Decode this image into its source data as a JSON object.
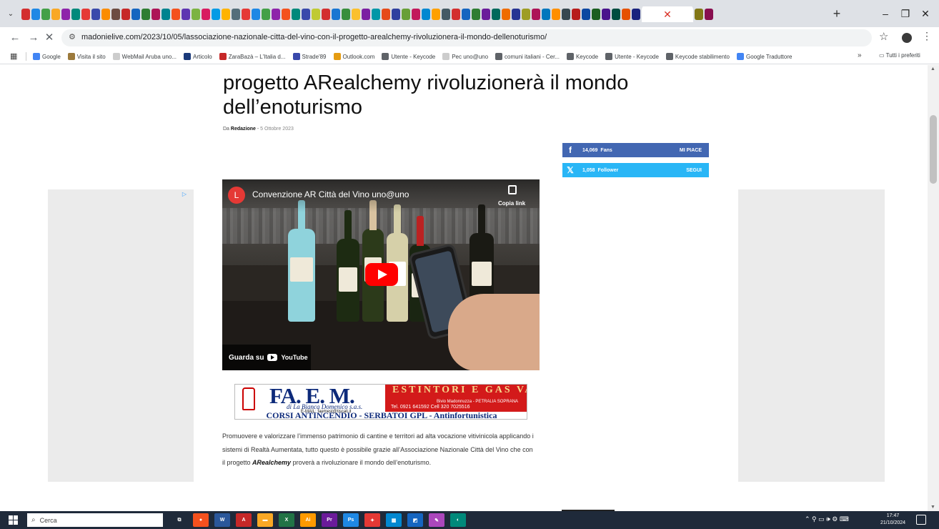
{
  "browser": {
    "url": "madonielive.com/2023/10/05/lassociazione-nazionale-citta-del-vino-con-il-progetto-arealchemy-rivoluzionera-il-mondo-dellenoturismo/",
    "bookmarks": [
      {
        "label": "Google",
        "color": "#4285f4"
      },
      {
        "label": "Visita il sito",
        "color": "#9c7a3c"
      },
      {
        "label": "WebMail Aruba uno...",
        "color": "#cccccc"
      },
      {
        "label": "Articolo",
        "color": "#1a3a7a"
      },
      {
        "label": "ZaraBazà – L'Italia d...",
        "color": "#c62828"
      },
      {
        "label": "Strade'89",
        "color": "#3949ab"
      },
      {
        "label": "Outlook.com",
        "color": "#e59c12"
      },
      {
        "label": "Utente - Keycode",
        "color": "#5f6368"
      },
      {
        "label": "Pec uno@uno",
        "color": "#cccccc"
      },
      {
        "label": "comuni italiani - Cer...",
        "color": "#5f6368"
      },
      {
        "label": "Keycode",
        "color": "#5f6368"
      },
      {
        "label": "Utente - Keycode",
        "color": "#5f6368"
      },
      {
        "label": "Keycode stabilimento",
        "color": "#5f6368"
      },
      {
        "label": "Google Traduttore",
        "color": "#4285f4"
      }
    ],
    "bookmarks_more": "»",
    "all_bookmarks": "Tutti i preferiti"
  },
  "article": {
    "title": "progetto ARealchemy rivoluzionerà il mondo dell’enoturismo",
    "byline_prefix": "Da",
    "author": "Redazione",
    "byline_sep": "-",
    "date": "5 Ottobre 2023",
    "body_start": "Promuovere e valorizzare l’immenso patrimonio di cantine e territori ad alta vocazione vitivinicola applicando i sistemi di Realtà Aumentata, tutto questo è possibile grazie all’Associazione Nazionale Città del Vino che con il progetto ",
    "body_emph": "ARealchemy",
    "body_end": " proverà a rivoluzionare il mondo dell’enoturismo."
  },
  "social": {
    "facebook": {
      "count": "14,069",
      "label": "Fans",
      "action": "MI PIACE",
      "color": "#4267b2"
    },
    "twitter": {
      "count": "1,058",
      "label": "Follower",
      "action": "SEGUI",
      "color": "#29b6f6"
    }
  },
  "video": {
    "channel_initial": "L",
    "title": "Convenzione AR Città del Vino uno@uno",
    "copy_link": "Copia link",
    "watch_on": "Guarda su",
    "youtube": "YouTube"
  },
  "banner": {
    "name": "FA. E. M.",
    "owner": "di La Bianca Domenico s.a.s.",
    "email": "E-MAIL: faemest@tiscali.it",
    "red_title": "ESTINTORI E GAS VARI",
    "address": "Bivio Madonnuzza - PETRALIA SOPRANA",
    "phone": "Tel. 0921 641592 Cell 320 7025516",
    "footer": "CORSI ANTINCENDIO - SERBATOI GPL - Antinfortunistica"
  },
  "taskbar": {
    "search_placeholder": "Cerca",
    "time": "17:47",
    "date": "21/10/2024"
  }
}
